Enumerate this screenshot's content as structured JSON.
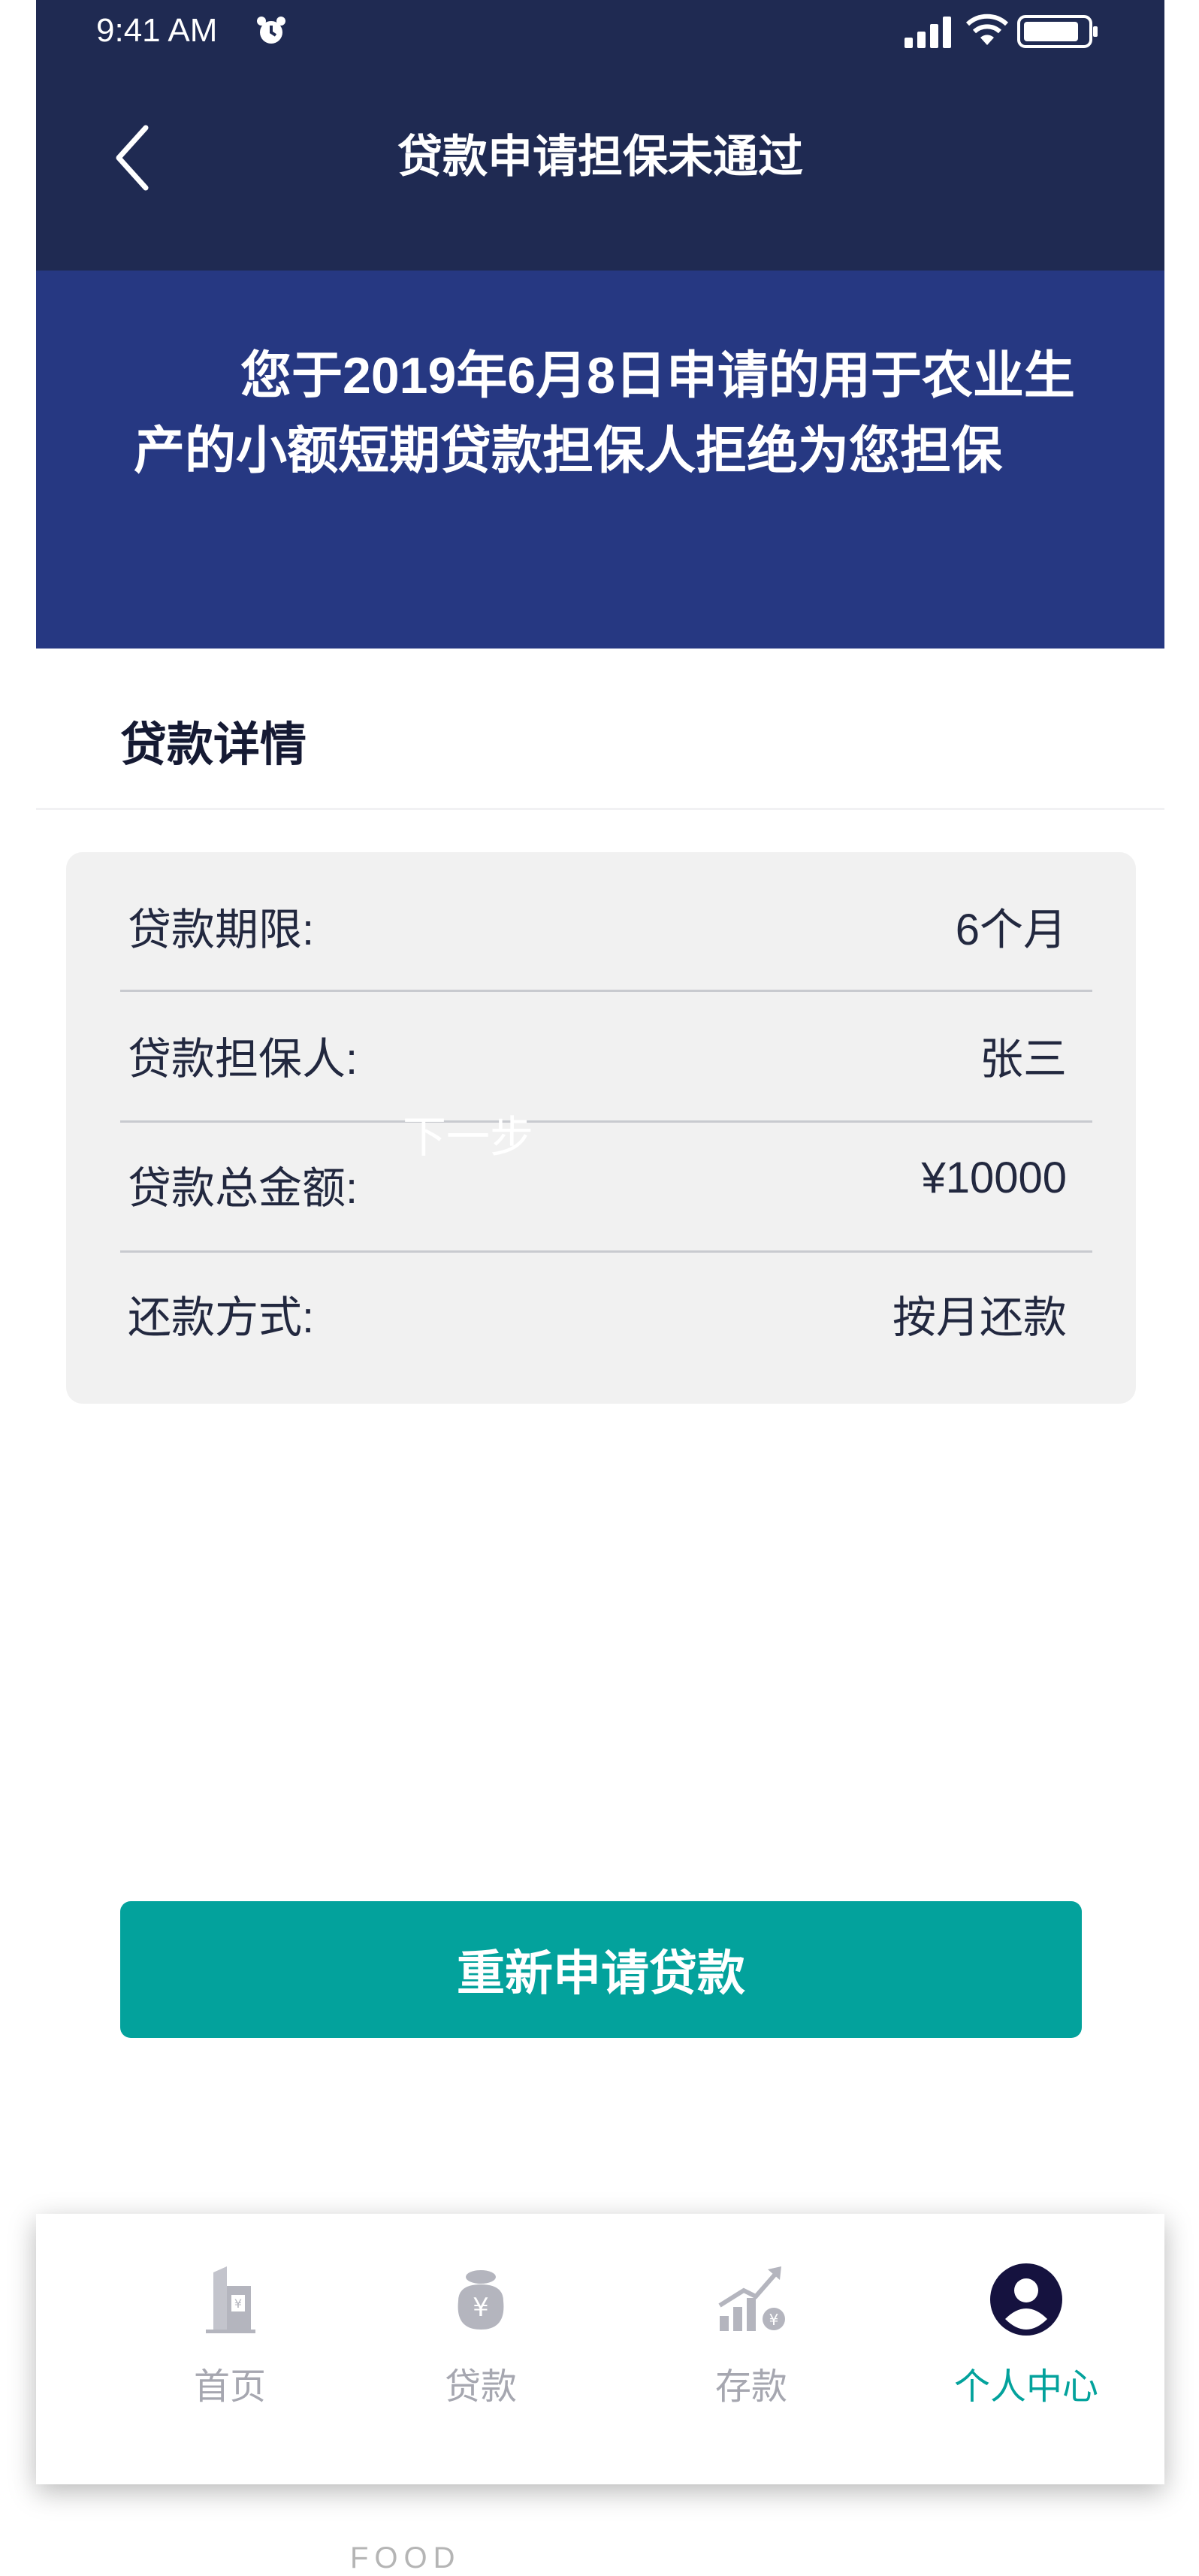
{
  "status_bar": {
    "time": "9:41 AM"
  },
  "nav": {
    "title": "贷款申请担保未通过"
  },
  "banner": {
    "message": "您于2019年6月8日申请的用于农业生产的小额短期贷款担保人拒绝为您担保"
  },
  "section": {
    "title": "贷款详情"
  },
  "details": [
    {
      "label": "贷款期限:",
      "value": "6个月"
    },
    {
      "label": "贷款担保人:",
      "value": "张三"
    },
    {
      "label": "贷款总金额:",
      "value": "¥10000"
    },
    {
      "label": "还款方式:",
      "value": "按月还款"
    }
  ],
  "overlay_text": "下一步",
  "primary_button": {
    "label": "重新申请贷款"
  },
  "tabs": [
    {
      "label": "首页",
      "icon": "building-icon",
      "active": false
    },
    {
      "label": "贷款",
      "icon": "money-bag-icon",
      "active": false
    },
    {
      "label": "存款",
      "icon": "growth-chart-icon",
      "active": false
    },
    {
      "label": "个人中心",
      "icon": "user-profile-icon",
      "active": true
    }
  ],
  "footer_text": "FOOD",
  "colors": {
    "header_bg": "#1f2a52",
    "banner_bg": "#263882",
    "accent": "#03a29c",
    "card_bg": "#f1f1f1",
    "inactive_tab": "#a6a7b0"
  }
}
